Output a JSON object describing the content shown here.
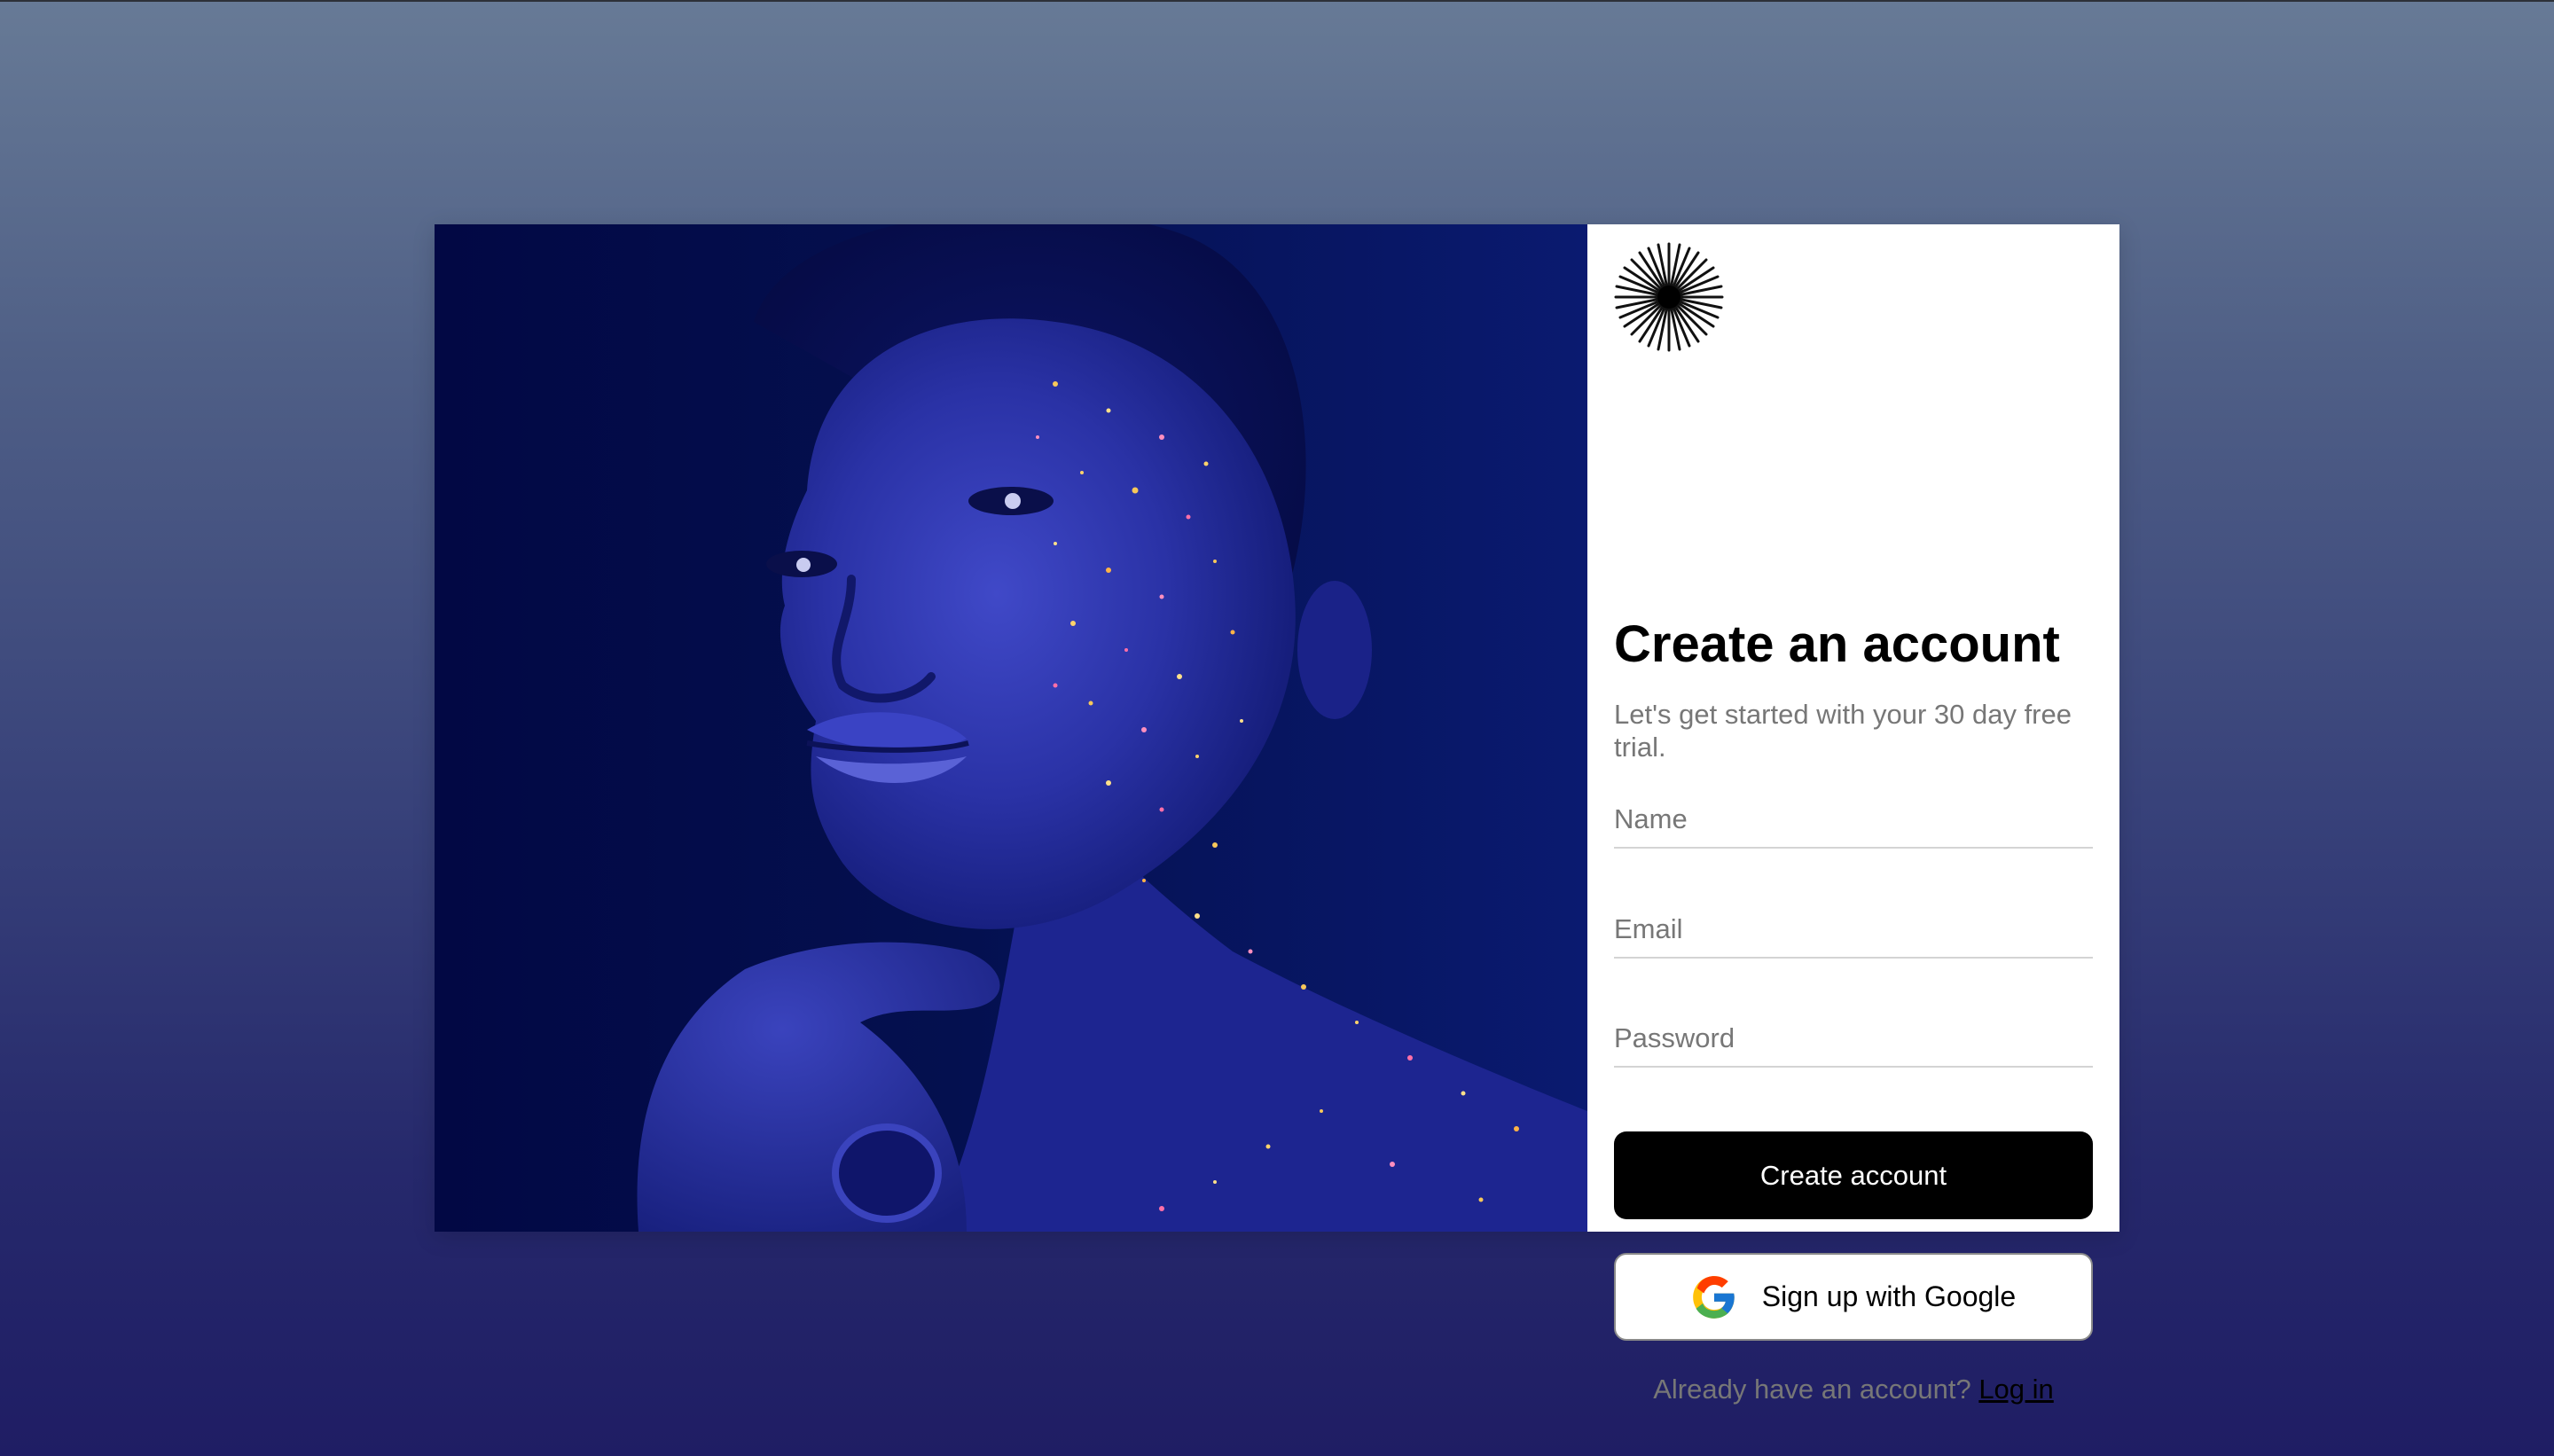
{
  "hero": {
    "image": "portrait-glitter-blue"
  },
  "brand": {
    "logo": "starburst-logo-icon"
  },
  "form": {
    "title": "Create an account",
    "subtitle": "Let's get started with your 30 day free trial.",
    "name_placeholder": "Name",
    "email_placeholder": "Email",
    "password_placeholder": "Password",
    "submit_label": "Create account",
    "google_label": "Sign up with Google",
    "google_icon": "google-g-icon",
    "login_prompt": "Already have an account?",
    "login_link": "Log in"
  },
  "colors": {
    "background_top": "#677a96",
    "background_bottom": "#1f1d64",
    "hero_base": "#030a4a",
    "primary_button": "#000000",
    "panel": "#ffffff"
  }
}
